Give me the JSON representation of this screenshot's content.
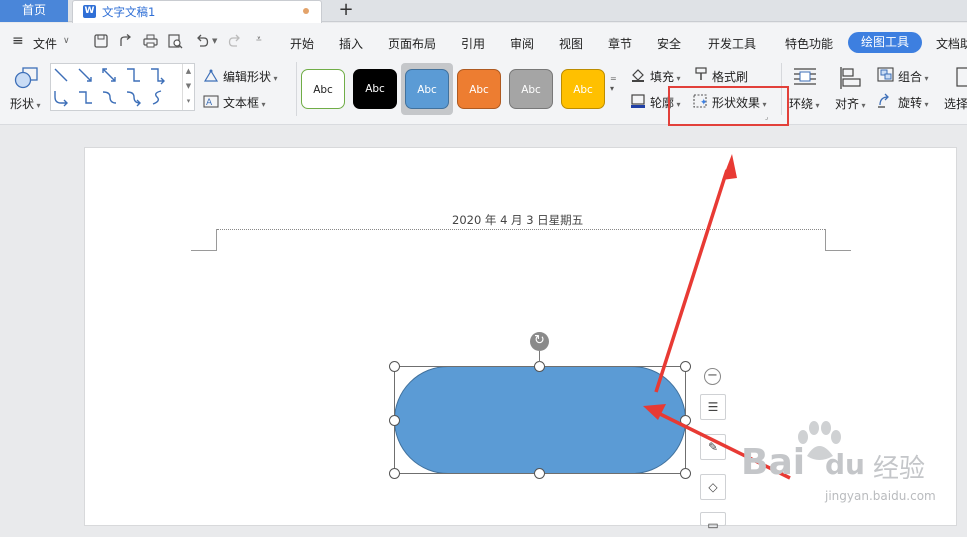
{
  "tabs": {
    "home": "首页",
    "doc": "文字文稿1",
    "new_tab": "+"
  },
  "menu": {
    "file": "文件",
    "items": [
      "开始",
      "插入",
      "页面布局",
      "引用",
      "审阅",
      "视图",
      "章节",
      "安全",
      "开发工具",
      "特色功能"
    ],
    "active": "绘图工具",
    "overflow": "文档助"
  },
  "ribbon": {
    "shape_label": "形状",
    "edit_shape": "编辑形状",
    "textbox": "文本框",
    "style_presets": [
      "Abc",
      "Abc",
      "Abc",
      "Abc",
      "Abc",
      "Abc"
    ],
    "fill": "填充",
    "format_painter": "格式刷",
    "outline": "轮廓",
    "shape_effects": "形状效果",
    "wrap": "环绕",
    "align": "对齐",
    "group": "组合",
    "rotate": "旋转",
    "select": "选择"
  },
  "colors": {
    "accent": "#3d7fe0",
    "shape_fill": "#5b9bd5",
    "highlight": "#e2403a",
    "preset_fills": [
      "#ffffff",
      "#000000",
      "#5b9bd5",
      "#ed7d31",
      "#a5a5a5",
      "#ffc000"
    ]
  },
  "document": {
    "header_date": "2020 年 4 月 3 日星期五"
  },
  "watermark": {
    "brand": "Bai",
    "brand2": "du",
    "suffix": "经验",
    "url": "jingyan.baidu.com"
  }
}
